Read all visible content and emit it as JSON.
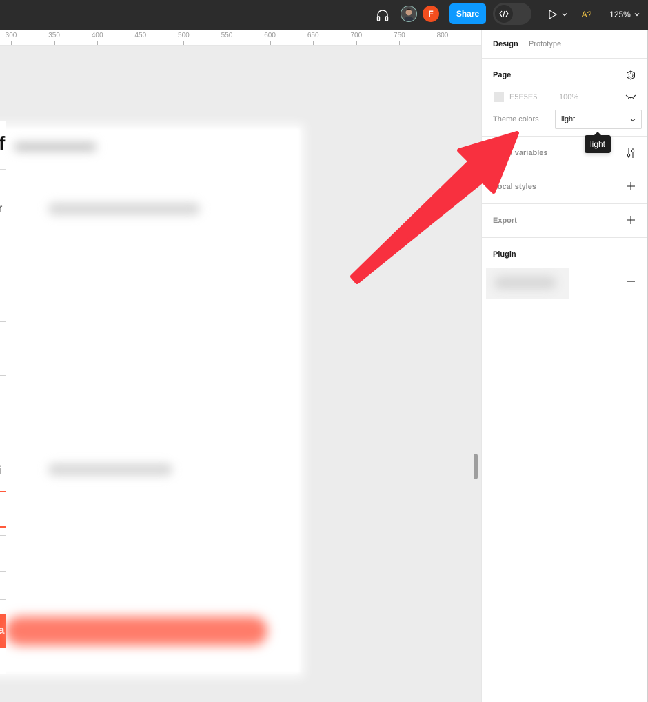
{
  "topbar": {
    "share_label": "Share",
    "avatar_initial": "F",
    "ai_label": "A?",
    "zoom_label": "125%",
    "accent_color": "#0d99ff",
    "avatar_color": "#f24e1e"
  },
  "ruler": {
    "ticks": [
      "300",
      "350",
      "400",
      "450",
      "500",
      "550",
      "600",
      "650",
      "700",
      "750",
      "800"
    ]
  },
  "canvas": {
    "frame_partial_title": "f",
    "partial_text_1": "r",
    "partial_text_2": "i",
    "partial_button_text": "a",
    "button_color": "#ff5a3c"
  },
  "panel": {
    "tabs": [
      {
        "label": "Design",
        "active": true
      },
      {
        "label": "Prototype",
        "active": false
      }
    ],
    "page": {
      "title": "Page",
      "color_hex": "E5E5E5",
      "opacity": "100%",
      "theme_label": "Theme colors",
      "theme_value": "light",
      "tooltip": "light"
    },
    "sections": [
      {
        "label": "Local variables",
        "icon": "sliders-icon"
      },
      {
        "label": "Local styles",
        "icon": "plus-icon"
      },
      {
        "label": "Export",
        "icon": "plus-icon"
      }
    ],
    "plugin": {
      "title": "Plugin",
      "icon": "minus-icon"
    }
  },
  "annotation": {
    "arrow_color": "#f8303f"
  }
}
